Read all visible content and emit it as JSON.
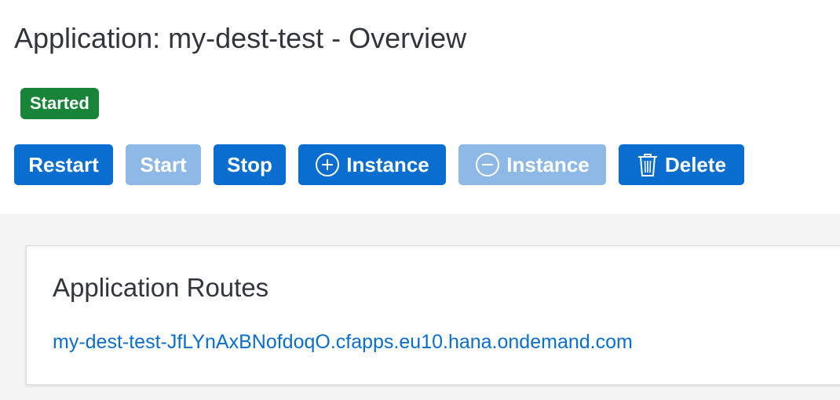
{
  "page": {
    "title": "Application: my-dest-test - Overview"
  },
  "status": {
    "label": "Started",
    "color": "#188437"
  },
  "toolbar": {
    "restart_label": "Restart",
    "start_label": "Start",
    "stop_label": "Stop",
    "add_instance_label": "Instance",
    "remove_instance_label": "Instance",
    "delete_label": "Delete",
    "add_instance_icon": "plus-circle-icon",
    "remove_instance_icon": "minus-circle-icon",
    "delete_icon": "trash-icon",
    "disabled": [
      "start",
      "remove_instance"
    ]
  },
  "routes": {
    "title": "Application Routes",
    "items": [
      "my-dest-test-JfLYnAxBNofdoqO.cfapps.eu10.hana.ondemand.com"
    ]
  },
  "colors": {
    "accent": "#0a6ed1",
    "accent_disabled": "#8eb8e5",
    "text": "#32363a",
    "background_shell": "#f4f4f4"
  }
}
